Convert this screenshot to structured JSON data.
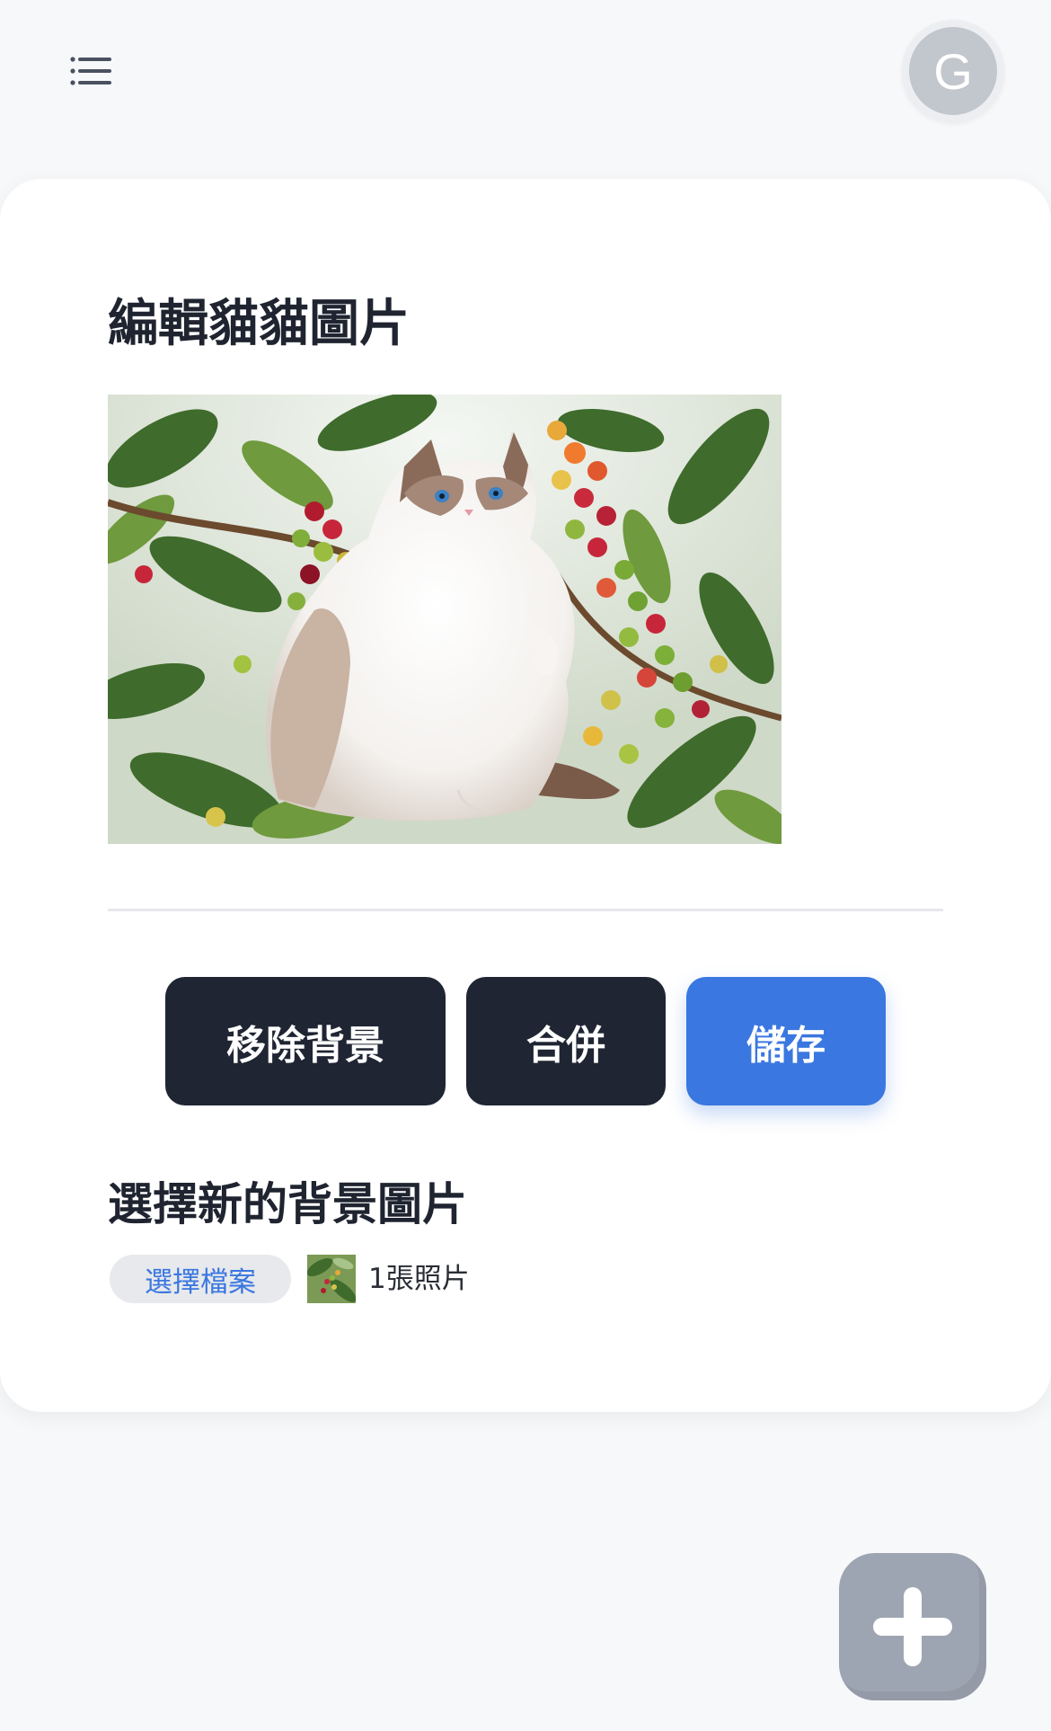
{
  "header": {
    "menu_icon": "hamburger-menu-icon",
    "avatar_initial": "G"
  },
  "editor": {
    "title": "編輯貓貓圖片",
    "preview_description": "ragdoll-cat-on-coffee-berry-branches"
  },
  "actions": {
    "remove_bg_label": "移除背景",
    "merge_label": "合併",
    "save_label": "儲存"
  },
  "background_picker": {
    "title": "選擇新的背景圖片",
    "choose_file_label": "選擇檔案",
    "file_count": "1張照片"
  },
  "fab": {
    "icon": "plus-icon"
  },
  "colors": {
    "primary_blue": "#3a77e0",
    "dark_button": "#1f2533",
    "fab_gray": "#9ea5b2",
    "page_bg": "#f7f8fa"
  }
}
